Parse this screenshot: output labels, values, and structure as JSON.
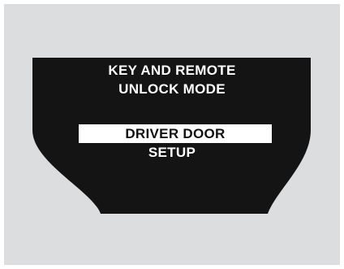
{
  "screen": {
    "title_line1": "KEY AND REMOTE",
    "title_line2": "UNLOCK MODE",
    "options": [
      {
        "label": "DRIVER DOOR",
        "selected": true
      },
      {
        "label": "SETUP",
        "selected": false
      }
    ]
  },
  "colors": {
    "background": "#dcdddf",
    "display": "#141414",
    "text": "#ffffff",
    "highlight": "#ffffff"
  }
}
